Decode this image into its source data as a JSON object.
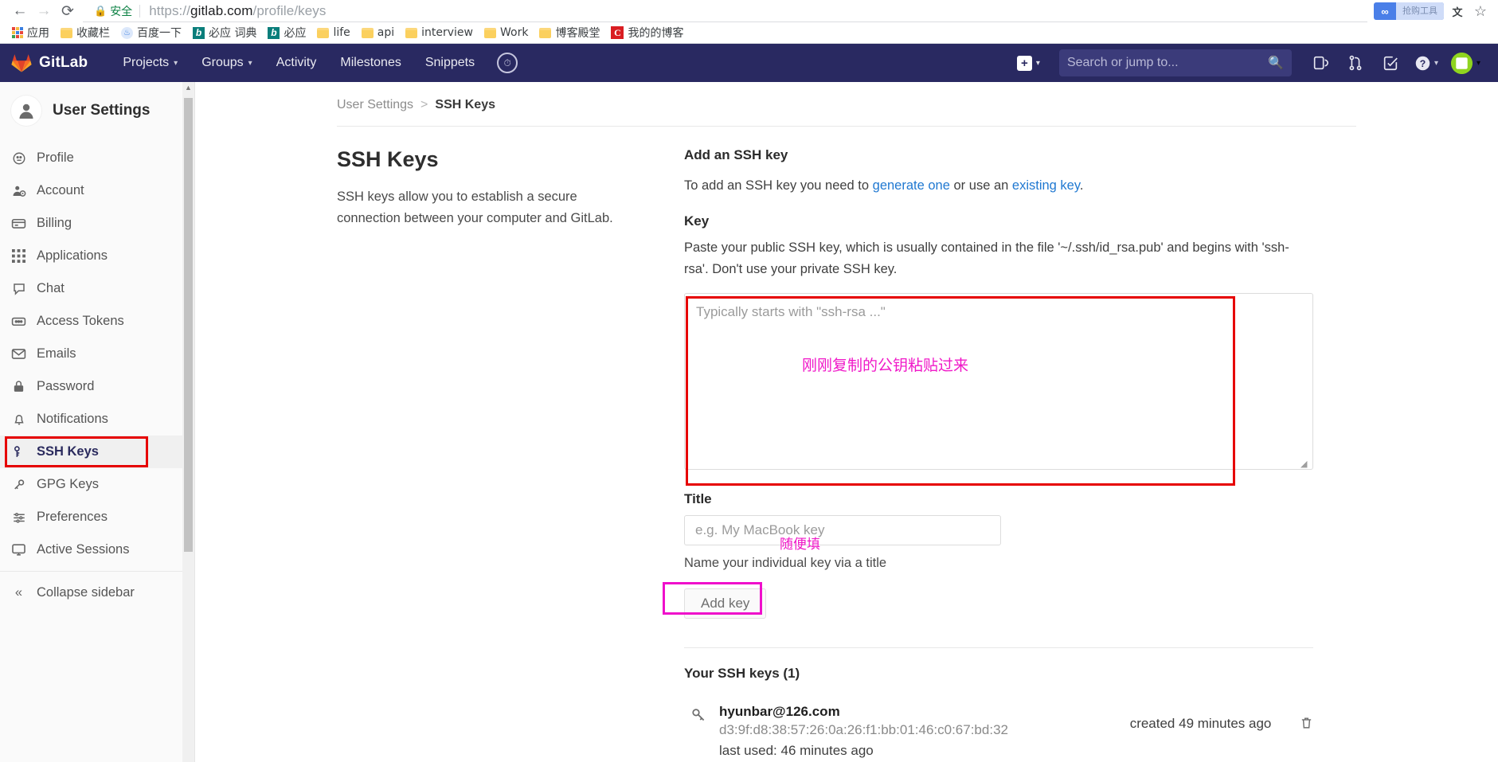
{
  "browser": {
    "back_icon": "back-arrow-icon",
    "forward_icon": "forward-arrow-icon",
    "reload_icon": "reload-icon",
    "security_label": "安全",
    "lock_icon": "lock-icon",
    "url_scheme": "https://",
    "url_domain": "gitlab.com",
    "url_path": "/profile/keys",
    "extension_badge_label": "抢购工具",
    "extension_badge_icon": "infinity-icon",
    "translate_icon": "translate-icon",
    "bookmark_star_icon": "star-icon",
    "bookmarks": [
      {
        "label": "应用",
        "icon": "apps-grid-icon"
      },
      {
        "label": "收藏栏",
        "icon": "folder-icon"
      },
      {
        "label": "百度一下",
        "icon": "baidu-paw-icon"
      },
      {
        "label": "必应 词典",
        "icon": "bing-icon"
      },
      {
        "label": "必应",
        "icon": "bing-icon"
      },
      {
        "label": "life",
        "icon": "folder-icon"
      },
      {
        "label": "api",
        "icon": "folder-icon"
      },
      {
        "label": "interview",
        "icon": "folder-icon"
      },
      {
        "label": "Work",
        "icon": "folder-icon"
      },
      {
        "label": "博客殿堂",
        "icon": "folder-icon"
      },
      {
        "label": "我的的博客",
        "icon": "csdn-icon"
      }
    ]
  },
  "navbar": {
    "brand": "GitLab",
    "brand_icon": "gitlab-tanuki-logo",
    "items": [
      {
        "label": "Projects",
        "has_caret": true
      },
      {
        "label": "Groups",
        "has_caret": true
      },
      {
        "label": "Activity",
        "has_caret": false
      },
      {
        "label": "Milestones",
        "has_caret": false
      },
      {
        "label": "Snippets",
        "has_caret": false
      }
    ],
    "speedometer_icon": "speedometer-icon",
    "plus_icon": "plus-icon",
    "search_placeholder": "Search or jump to...",
    "search_value": "",
    "search_icon": "search-icon",
    "issues_icon": "issues-icon",
    "merge_requests_icon": "merge-request-icon",
    "todos_icon": "todo-checklist-icon",
    "help_icon": "question-mark-icon",
    "avatar_icon": "user-avatar",
    "colors": {
      "navbar_bg": "#292961",
      "search_bg": "#3b3b7a",
      "avatar": "#8fd41f"
    }
  },
  "sidebar": {
    "title": "User Settings",
    "avatar_icon": "user-avatar-icon",
    "items": [
      {
        "label": "Profile",
        "icon": "profile-circle-icon",
        "active": false
      },
      {
        "label": "Account",
        "icon": "account-gear-icon",
        "active": false
      },
      {
        "label": "Billing",
        "icon": "credit-card-icon",
        "active": false
      },
      {
        "label": "Applications",
        "icon": "applications-grid-icon",
        "active": false
      },
      {
        "label": "Chat",
        "icon": "chat-bubble-icon",
        "active": false
      },
      {
        "label": "Access Tokens",
        "icon": "token-icon",
        "active": false
      },
      {
        "label": "Emails",
        "icon": "envelope-icon",
        "active": false
      },
      {
        "label": "Password",
        "icon": "padlock-icon",
        "active": false
      },
      {
        "label": "Notifications",
        "icon": "bell-icon",
        "active": false
      },
      {
        "label": "SSH Keys",
        "icon": "ssh-key-icon",
        "active": true
      },
      {
        "label": "GPG Keys",
        "icon": "gpg-key-icon",
        "active": false
      },
      {
        "label": "Preferences",
        "icon": "sliders-icon",
        "active": false
      },
      {
        "label": "Active Sessions",
        "icon": "monitor-icon",
        "active": false
      }
    ],
    "collapse_label": "Collapse sidebar",
    "collapse_icon": "double-chevron-left-icon",
    "scrollbar_up_icon": "scroll-up-arrow-icon"
  },
  "breadcrumb": {
    "parent": "User Settings",
    "separator": ">",
    "current": "SSH Keys"
  },
  "left_panel": {
    "heading": "SSH Keys",
    "description": "SSH keys allow you to establish a secure connection between your computer and GitLab."
  },
  "form": {
    "section_title": "Add an SSH key",
    "intro_prefix": "To add an SSH key you need to ",
    "intro_link1": "generate one",
    "intro_middle": " or use an ",
    "intro_link2": "existing key",
    "intro_suffix": ".",
    "key_label": "Key",
    "key_help": "Paste your public SSH key, which is usually contained in the file '~/.ssh/id_rsa.pub' and begins with 'ssh-rsa'. Don't use your private SSH key.",
    "key_placeholder": "Typically starts with \"ssh-rsa ...\"",
    "key_value": "",
    "title_label": "Title",
    "title_placeholder": "e.g. My MacBook key",
    "title_value": "",
    "title_helper": "Name your individual key via a title",
    "submit_label": "Add key",
    "resize_handle_icon": "resize-handle-icon"
  },
  "annotations": {
    "key_box_color": "#e60000",
    "key_note": "刚刚复制的公钥粘贴过来",
    "title_note": "随便填",
    "button_box_color": "#ef0fcb",
    "note_color": "#f018c8",
    "sidebar_box_color": "#e60000"
  },
  "keys_list": {
    "heading": "Your SSH keys (1)",
    "rows": [
      {
        "icon": "key-icon",
        "email": "hyunbar@126.com",
        "fingerprint": "d3:9f:d8:38:57:26:0a:26:f1:bb:01:46:c0:67:bd:32",
        "last_used": "last used: 46 minutes ago",
        "created": "created 49 minutes ago",
        "delete_icon": "trash-icon"
      }
    ]
  }
}
